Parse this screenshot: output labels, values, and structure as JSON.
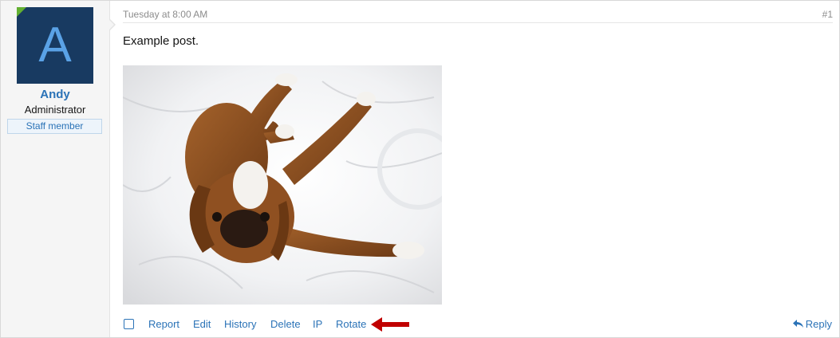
{
  "user": {
    "avatar_letter": "A",
    "name": "Andy",
    "title": "Administrator",
    "banner": "Staff member",
    "avatar_color": "#183a61",
    "online_color": "#63b031"
  },
  "post": {
    "date": "Tuesday at 8:00 AM",
    "number": "#1",
    "message": "Example post.",
    "image": "photo of a boxer dog lying on white sheets"
  },
  "actions": {
    "report": "Report",
    "edit": "Edit",
    "history": "History",
    "delete": "Delete",
    "ip": "IP",
    "rotate": "Rotate",
    "reply": "Reply"
  },
  "colors": {
    "link": "#2b73b7",
    "arrow": "#c00000"
  }
}
